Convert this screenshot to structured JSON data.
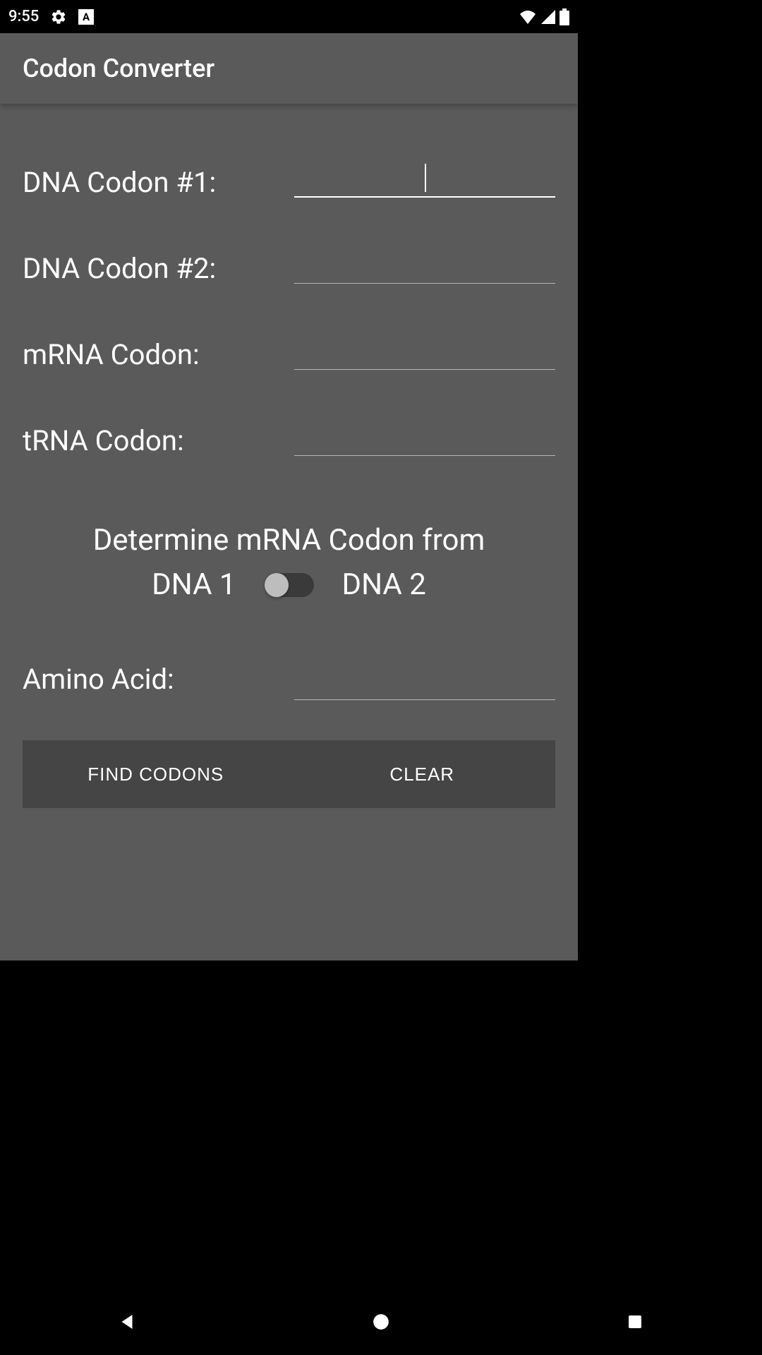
{
  "status": {
    "time": "9:55",
    "icons": [
      "settings",
      "app-badge"
    ],
    "right_icons": [
      "wifi",
      "cell",
      "battery"
    ]
  },
  "app": {
    "title": "Codon Converter"
  },
  "form": {
    "dna1_label": "DNA Codon #1:",
    "dna1_value": "",
    "dna2_label": "DNA Codon #2:",
    "dna2_value": "",
    "mrna_label": "mRNA Codon:",
    "mrna_value": "",
    "trna_label": "tRNA Codon:",
    "trna_value": ""
  },
  "switch": {
    "title": "Determine mRNA Codon from",
    "left": "DNA 1",
    "right": "DNA 2",
    "state": "left"
  },
  "amino": {
    "label": "Amino Acid:",
    "value": ""
  },
  "buttons": {
    "find": "FIND CODONS",
    "clear": "CLEAR"
  }
}
